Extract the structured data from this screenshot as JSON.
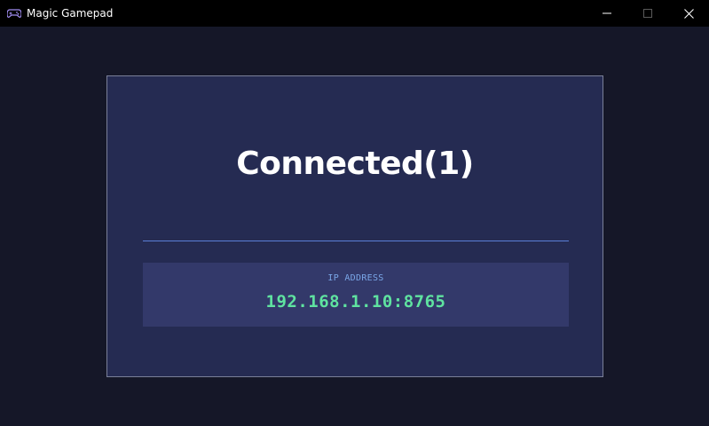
{
  "window": {
    "title": "Magic Gamepad",
    "app_icon": "gamepad-icon",
    "controls": [
      "minimize-icon",
      "maximize-icon",
      "close-icon"
    ]
  },
  "main": {
    "status_text": "Connected(1)",
    "ip_label": "IP ADDRESS",
    "ip_value": "192.168.1.10:8765"
  },
  "colors": {
    "background": "#151728",
    "card": "#252b52",
    "ip_box": "#33396a",
    "divider": "#5a7fd6",
    "ip_label": "#7aa7e8",
    "ip_value": "#5fe3a0",
    "titlebar": "#000000"
  }
}
